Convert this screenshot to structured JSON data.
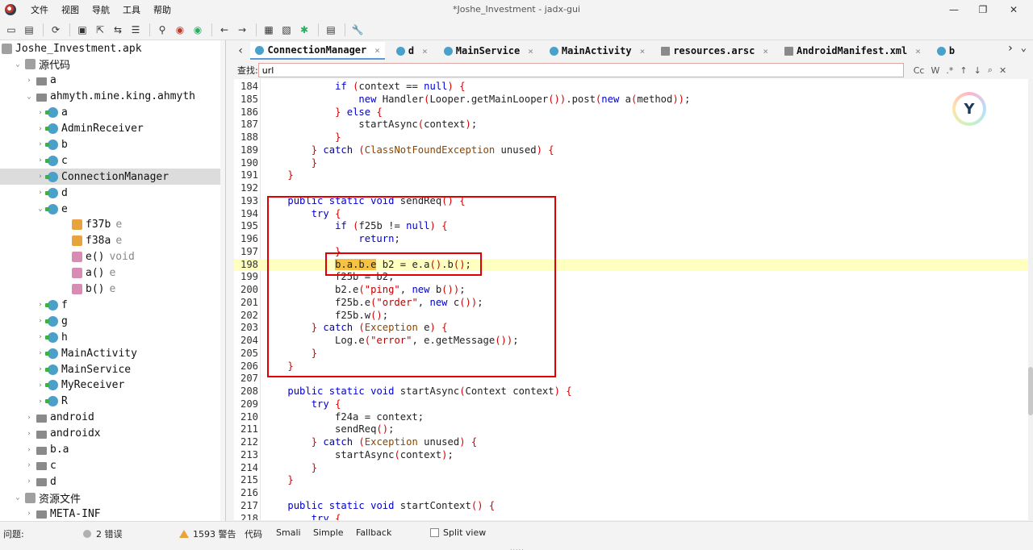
{
  "window": {
    "title": "*Joshe_Investment - jadx-gui",
    "minimize": "—",
    "maximize": "❐",
    "close": "✕"
  },
  "menu": [
    "文件",
    "视图",
    "导航",
    "工具",
    "帮助"
  ],
  "toolbar_icons": [
    "open-icon",
    "add-file-icon",
    "refresh-icon",
    "save-icon",
    "export-icon",
    "sync-icon",
    "flatten-icon",
    "search-icon",
    "find-class-icon",
    "find-usage-icon",
    "back-icon",
    "forward-icon",
    "deobfuscation-icon",
    "quick-tabs-icon",
    "debug-icon",
    "log-icon",
    "preferences-icon"
  ],
  "tree": {
    "rows": [
      {
        "label": "Joshe_Investment.apk",
        "type": "",
        "indent": 0,
        "icon": "apk",
        "toggle": ""
      },
      {
        "label": "源代码",
        "type": "",
        "indent": 1,
        "icon": "pkg",
        "toggle": "⌄"
      },
      {
        "label": "a",
        "type": "",
        "indent": 2,
        "icon": "folder",
        "toggle": "›"
      },
      {
        "label": "ahmyth.mine.king.ahmyth",
        "type": "",
        "indent": 2,
        "icon": "folder",
        "toggle": "⌄"
      },
      {
        "label": "a",
        "type": "",
        "indent": 3,
        "icon": "class",
        "toggle": "›"
      },
      {
        "label": "AdminReceiver",
        "type": "",
        "indent": 3,
        "icon": "class",
        "toggle": "›"
      },
      {
        "label": "b",
        "type": "",
        "indent": 3,
        "icon": "class",
        "toggle": "›"
      },
      {
        "label": "c",
        "type": "",
        "indent": 3,
        "icon": "class",
        "toggle": "›"
      },
      {
        "label": "ConnectionManager",
        "type": "",
        "indent": 3,
        "icon": "class",
        "toggle": "›",
        "selected": true
      },
      {
        "label": "d",
        "type": "",
        "indent": 3,
        "icon": "class",
        "toggle": "›"
      },
      {
        "label": "e",
        "type": "",
        "indent": 3,
        "icon": "class",
        "toggle": "⌄"
      },
      {
        "label": "f37b",
        "type": "e",
        "indent": 4,
        "icon": "field",
        "toggle": ""
      },
      {
        "label": "f38a",
        "type": "e",
        "indent": 4,
        "icon": "field",
        "toggle": ""
      },
      {
        "label": "e()",
        "type": "void",
        "indent": 4,
        "icon": "method",
        "toggle": ""
      },
      {
        "label": "a()",
        "type": "e",
        "indent": 4,
        "icon": "method",
        "toggle": ""
      },
      {
        "label": "b()",
        "type": "e",
        "indent": 4,
        "icon": "method",
        "toggle": ""
      },
      {
        "label": "f",
        "type": "",
        "indent": 3,
        "icon": "class",
        "toggle": "›"
      },
      {
        "label": "g",
        "type": "",
        "indent": 3,
        "icon": "class",
        "toggle": "›"
      },
      {
        "label": "h",
        "type": "",
        "indent": 3,
        "icon": "class",
        "toggle": "›"
      },
      {
        "label": "MainActivity",
        "type": "",
        "indent": 3,
        "icon": "class",
        "toggle": "›"
      },
      {
        "label": "MainService",
        "type": "",
        "indent": 3,
        "icon": "class",
        "toggle": "›"
      },
      {
        "label": "MyReceiver",
        "type": "",
        "indent": 3,
        "icon": "class",
        "toggle": "›"
      },
      {
        "label": "R",
        "type": "",
        "indent": 3,
        "icon": "class",
        "toggle": "›"
      },
      {
        "label": "android",
        "type": "",
        "indent": 2,
        "icon": "folder",
        "toggle": "›"
      },
      {
        "label": "androidx",
        "type": "",
        "indent": 2,
        "icon": "folder",
        "toggle": "›"
      },
      {
        "label": "b.a",
        "type": "",
        "indent": 2,
        "icon": "folder",
        "toggle": "›"
      },
      {
        "label": "c",
        "type": "",
        "indent": 2,
        "icon": "folder",
        "toggle": "›"
      },
      {
        "label": "d",
        "type": "",
        "indent": 2,
        "icon": "folder",
        "toggle": "›"
      },
      {
        "label": "资源文件",
        "type": "",
        "indent": 1,
        "icon": "pkg",
        "toggle": "⌄"
      },
      {
        "label": "META-INF",
        "type": "",
        "indent": 2,
        "icon": "folder",
        "toggle": "›"
      }
    ]
  },
  "tabs": [
    {
      "label": "ConnectionManager",
      "icon": "class",
      "active": true
    },
    {
      "label": "d",
      "icon": "class",
      "active": false
    },
    {
      "label": "MainService",
      "icon": "class",
      "active": false
    },
    {
      "label": "MainActivity",
      "icon": "class",
      "active": false
    },
    {
      "label": "resources.arsc",
      "icon": "file",
      "active": false
    },
    {
      "label": "AndroidManifest.xml",
      "icon": "file",
      "active": false
    },
    {
      "label": "b",
      "icon": "class",
      "active": false
    }
  ],
  "tab_nav": {
    "prev": "‹",
    "next": "›",
    "more": "⌄"
  },
  "search": {
    "label": "查找:",
    "value": "url",
    "options": [
      "Cc",
      "W",
      ".*",
      "↑",
      "↓",
      "⌕",
      "✕"
    ]
  },
  "code": {
    "lines": [
      {
        "n": "184",
        "html": "            <span class='kw'>if</span> <span class='br'>(</span>context == <span class='kw'>null</span><span class='br'>)</span> <span class='br'>{</span>"
      },
      {
        "n": "185",
        "html": "                <span class='kw'>new</span> Handler<span class='br'>(</span>Looper.getMainLooper<span class='br'>())</span>.post<span class='br'>(</span><span class='kw'>new</span> a<span class='br'>(</span>method<span class='br'>))</span>;"
      },
      {
        "n": "186",
        "html": "            <span class='br'>}</span> <span class='kw'>else</span> <span class='br'>{</span>"
      },
      {
        "n": "187",
        "html": "                startAsync<span class='br'>(</span>context<span class='br'>)</span>;"
      },
      {
        "n": "188",
        "html": "            <span class='br'>}</span>"
      },
      {
        "n": "189",
        "html": "        <span class='br'>}</span> <span class='kw'>catch</span> <span class='br'>(</span><span class='ty'>ClassNotFoundException</span> unused<span class='br'>)</span> <span class='br'>{</span>"
      },
      {
        "n": "190",
        "html": "        <span class='br'>}</span>"
      },
      {
        "n": "191",
        "html": "    <span class='br'>}</span>"
      },
      {
        "n": "192",
        "html": ""
      },
      {
        "n": "193",
        "html": "    <span class='kw'>public</span> <span class='kw'>static</span> <span class='kw'>void</span> sendReq<span class='br'>()</span> <span class='br'>{</span>"
      },
      {
        "n": "194",
        "html": "        <span class='kw'>try</span> <span class='br'>{</span>"
      },
      {
        "n": "195",
        "html": "            <span class='kw'>if</span> <span class='br'>(</span>f25b != <span class='kw'>null</span><span class='br'>)</span> <span class='br'>{</span>"
      },
      {
        "n": "196",
        "html": "                <span class='kw'>return</span>;"
      },
      {
        "n": "197",
        "html": "            <span class='br'>}</span>"
      },
      {
        "n": "198",
        "html": "            <span class='sel'>b.a.b.e</span> b2 = e.a<span class='br'>()</span>.b<span class='br'>()</span>;",
        "highlight": true
      },
      {
        "n": "199",
        "html": "            f25b = b2;"
      },
      {
        "n": "200",
        "html": "            b2.e<span class='br'>(</span><span class='str'>\"ping\"</span>, <span class='kw'>new</span> b<span class='br'>())</span>;"
      },
      {
        "n": "201",
        "html": "            f25b.e<span class='br'>(</span><span class='str'>\"order\"</span>, <span class='kw'>new</span> c<span class='br'>())</span>;"
      },
      {
        "n": "202",
        "html": "            f25b.w<span class='br'>()</span>;"
      },
      {
        "n": "203",
        "html": "        <span class='br'>}</span> <span class='kw'>catch</span> <span class='br'>(</span><span class='ty'>Exception</span> e<span class='br'>)</span> <span class='br'>{</span>"
      },
      {
        "n": "204",
        "html": "            Log.e<span class='br'>(</span><span class='str'>\"error\"</span>, e.getMessage<span class='br'>())</span>;"
      },
      {
        "n": "205",
        "html": "        <span class='br'>}</span>"
      },
      {
        "n": "206",
        "html": "    <span class='br'>}</span>"
      },
      {
        "n": "207",
        "html": ""
      },
      {
        "n": "208",
        "html": "    <span class='kw'>public</span> <span class='kw'>static</span> <span class='kw'>void</span> startAsync<span class='br'>(</span>Context context<span class='br'>)</span> <span class='br'>{</span>"
      },
      {
        "n": "209",
        "html": "        <span class='kw'>try</span> <span class='br'>{</span>"
      },
      {
        "n": "210",
        "html": "            f24a = context;"
      },
      {
        "n": "211",
        "html": "            sendReq<span class='br'>()</span>;"
      },
      {
        "n": "212",
        "html": "        <span class='br'>}</span> <span class='kw'>catch</span> <span class='br'>(</span><span class='ty'>Exception</span> unused<span class='br'>)</span> <span class='br'>{</span>"
      },
      {
        "n": "213",
        "html": "            startAsync<span class='br'>(</span>context<span class='br'>)</span>;"
      },
      {
        "n": "214",
        "html": "        <span class='br'>}</span>"
      },
      {
        "n": "215",
        "html": "    <span class='br'>}</span>"
      },
      {
        "n": "216",
        "html": ""
      },
      {
        "n": "217",
        "html": "    <span class='kw'>public</span> <span class='kw'>static</span> <span class='kw'>void</span> startContext<span class='br'>()</span> <span class='br'>{</span>"
      },
      {
        "n": "218",
        "html": "        <span class='kw'>try</span> <span class='br'>{</span>"
      }
    ]
  },
  "status": {
    "problems_label": "问题:",
    "errors": "2 错误",
    "warnings": "1593 警告",
    "view_tabs": [
      "代码",
      "Smali",
      "Simple",
      "Fallback"
    ],
    "split_view": "Split view",
    "handle": "....."
  },
  "colors": {
    "keyword": "#0000cc",
    "string": "#c00000",
    "bracket": "#d40000",
    "highlight_line": "#ffffc0",
    "annotation_box": "#e00000"
  }
}
